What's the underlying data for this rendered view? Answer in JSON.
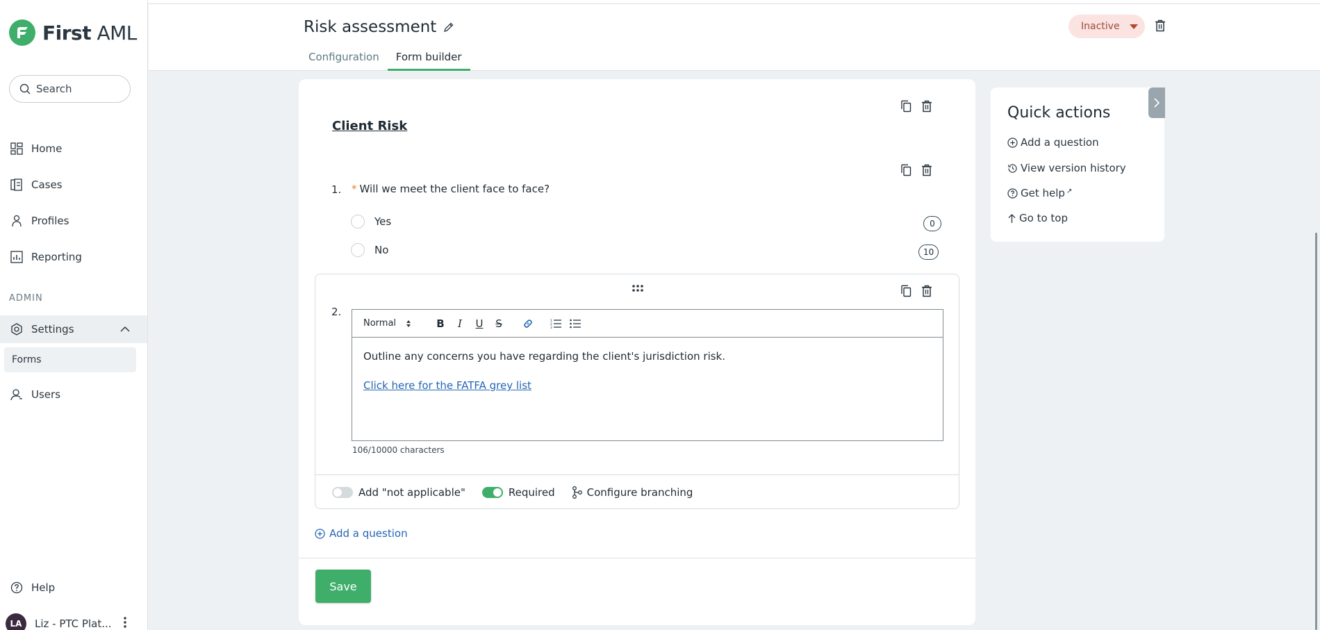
{
  "brand": {
    "name_bold": "First",
    "name_light": " AML",
    "accent": "#3fae6b"
  },
  "sidebar": {
    "search_placeholder": "Search",
    "items": [
      {
        "label": "Home",
        "icon": "grid-icon"
      },
      {
        "label": "Cases",
        "icon": "cases-icon"
      },
      {
        "label": "Profiles",
        "icon": "person-icon"
      },
      {
        "label": "Reporting",
        "icon": "chart-icon"
      }
    ],
    "admin_label": "ADMIN",
    "settings_label": "Settings",
    "forms_label": "Forms",
    "users_label": "Users",
    "help_label": "Help",
    "user": {
      "initials": "LA",
      "name": "Liz - PTC Plat..."
    }
  },
  "header": {
    "title": "Risk assessment",
    "tabs": [
      {
        "label": "Configuration",
        "active": false
      },
      {
        "label": "Form builder",
        "active": true
      }
    ],
    "status": "Inactive"
  },
  "form": {
    "section_title": "Client Risk",
    "questions": [
      {
        "number": "1.",
        "required_mark": "*",
        "text": "Will we meet the client face to face?",
        "options": [
          {
            "label": "Yes",
            "score": "0"
          },
          {
            "label": "No",
            "score": "10"
          }
        ]
      },
      {
        "number": "2.",
        "toolbar_format": "Normal",
        "body_text": "Outline any concerns you have regarding the client's jurisdiction risk.",
        "link_text": "Click here for the FATFA grey list",
        "char_count": "106/10000 characters",
        "not_applicable_label": "Add \"not applicable\"",
        "not_applicable_on": false,
        "required_label": "Required",
        "required_on": true,
        "branching_label": "Configure branching"
      }
    ],
    "add_question_label": "Add a question",
    "save_label": "Save"
  },
  "quick_actions": {
    "title": "Quick actions",
    "items": [
      {
        "label": "Add a question",
        "icon": "plus-circle-icon"
      },
      {
        "label": "View version history",
        "icon": "history-icon"
      },
      {
        "label": "Get help",
        "icon": "help-circle-icon"
      },
      {
        "label": "Go to top",
        "icon": "arrow-up-icon"
      }
    ],
    "external_mark": "↗"
  }
}
